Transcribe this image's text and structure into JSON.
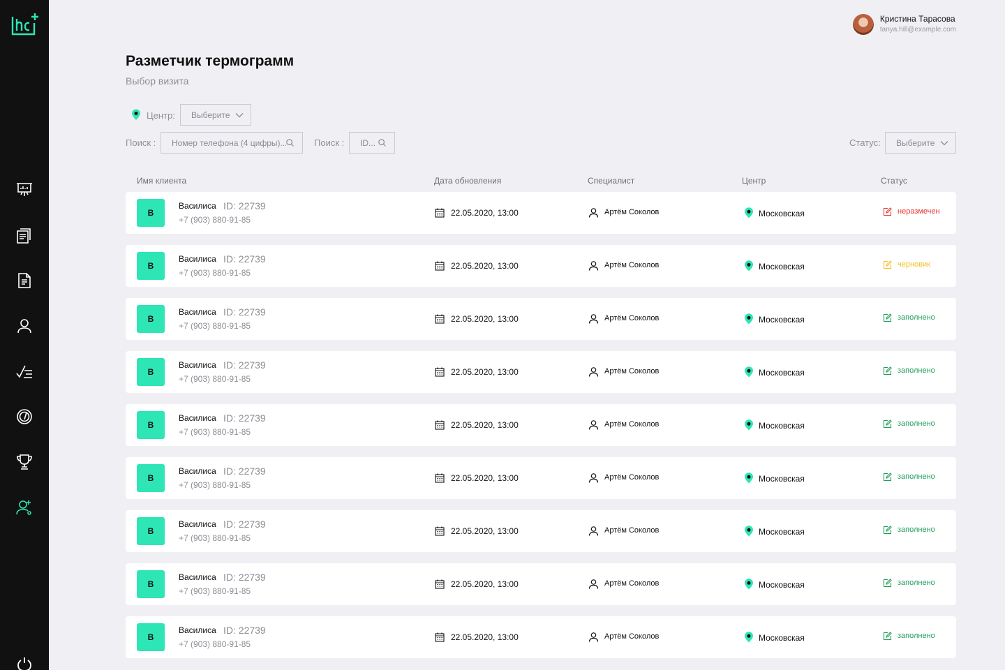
{
  "colors": {
    "sidebar_bg": "#111111",
    "accent": "#2ee5b5",
    "status_unmarked": "#e53935",
    "status_draft": "#f4c020",
    "status_filled": "#1e9e5a"
  },
  "user": {
    "name": "Кристина Тарасова",
    "email": "tanya.hill@example.com"
  },
  "page": {
    "title": "Разметчик термограмм",
    "subtitle": "Выбор визита"
  },
  "filters": {
    "center_label": "Центр:",
    "center_select": "Выберите",
    "search1_label": "Поиск :",
    "search1_placeholder": "Номер телефона (4 цифры)...",
    "search2_label": "Поиск :",
    "search2_placeholder": "ID...",
    "status_label": "Статус:",
    "status_select": "Выберите"
  },
  "sidebar": {
    "items": [
      {
        "icon": "presentation-icon",
        "active": false
      },
      {
        "icon": "documents-icon",
        "active": false
      },
      {
        "icon": "document-icon",
        "active": false
      },
      {
        "icon": "user-icon",
        "active": false
      },
      {
        "icon": "checklist-icon",
        "active": false
      },
      {
        "icon": "gauge-icon",
        "active": false
      },
      {
        "icon": "trophy-icon",
        "active": false
      },
      {
        "icon": "user-add-icon",
        "active": true
      }
    ]
  },
  "table": {
    "headers": [
      "Имя клиента",
      "Дата обновления",
      "Специалист",
      "Центр",
      "Статус"
    ],
    "rows": [
      {
        "initial": "В",
        "name": "Василиса",
        "id": "ID: 22739",
        "phone": "+7 (903) 880-91-85",
        "date": "22.05.2020, 13:00",
        "specialist": "Артём Соколов",
        "center": "Московская",
        "status": "неразмечен",
        "status_type": "unmarked"
      },
      {
        "initial": "В",
        "name": "Василиса",
        "id": "ID: 22739",
        "phone": "+7 (903) 880-91-85",
        "date": "22.05.2020, 13:00",
        "specialist": "Артём Соколов",
        "center": "Московская",
        "status": "черновик",
        "status_type": "draft"
      },
      {
        "initial": "В",
        "name": "Василиса",
        "id": "ID: 22739",
        "phone": "+7 (903) 880-91-85",
        "date": "22.05.2020, 13:00",
        "specialist": "Артём Соколов",
        "center": "Московская",
        "status": "заполнено",
        "status_type": "filled"
      },
      {
        "initial": "В",
        "name": "Василиса",
        "id": "ID: 22739",
        "phone": "+7 (903) 880-91-85",
        "date": "22.05.2020, 13:00",
        "specialist": "Артём Соколов",
        "center": "Московская",
        "status": "заполнено",
        "status_type": "filled"
      },
      {
        "initial": "В",
        "name": "Василиса",
        "id": "ID: 22739",
        "phone": "+7 (903) 880-91-85",
        "date": "22.05.2020, 13:00",
        "specialist": "Артём Соколов",
        "center": "Московская",
        "status": "заполнено",
        "status_type": "filled"
      },
      {
        "initial": "В",
        "name": "Василиса",
        "id": "ID: 22739",
        "phone": "+7 (903) 880-91-85",
        "date": "22.05.2020, 13:00",
        "specialist": "Артём Соколов",
        "center": "Московская",
        "status": "заполнено",
        "status_type": "filled"
      },
      {
        "initial": "В",
        "name": "Василиса",
        "id": "ID: 22739",
        "phone": "+7 (903) 880-91-85",
        "date": "22.05.2020, 13:00",
        "specialist": "Артём Соколов",
        "center": "Московская",
        "status": "заполнено",
        "status_type": "filled"
      },
      {
        "initial": "В",
        "name": "Василиса",
        "id": "ID: 22739",
        "phone": "+7 (903) 880-91-85",
        "date": "22.05.2020, 13:00",
        "specialist": "Артём Соколов",
        "center": "Московская",
        "status": "заполнено",
        "status_type": "filled"
      },
      {
        "initial": "В",
        "name": "Василиса",
        "id": "ID: 22739",
        "phone": "+7 (903) 880-91-85",
        "date": "22.05.2020, 13:00",
        "specialist": "Артём Соколов",
        "center": "Московская",
        "status": "заполнено",
        "status_type": "filled"
      }
    ]
  }
}
